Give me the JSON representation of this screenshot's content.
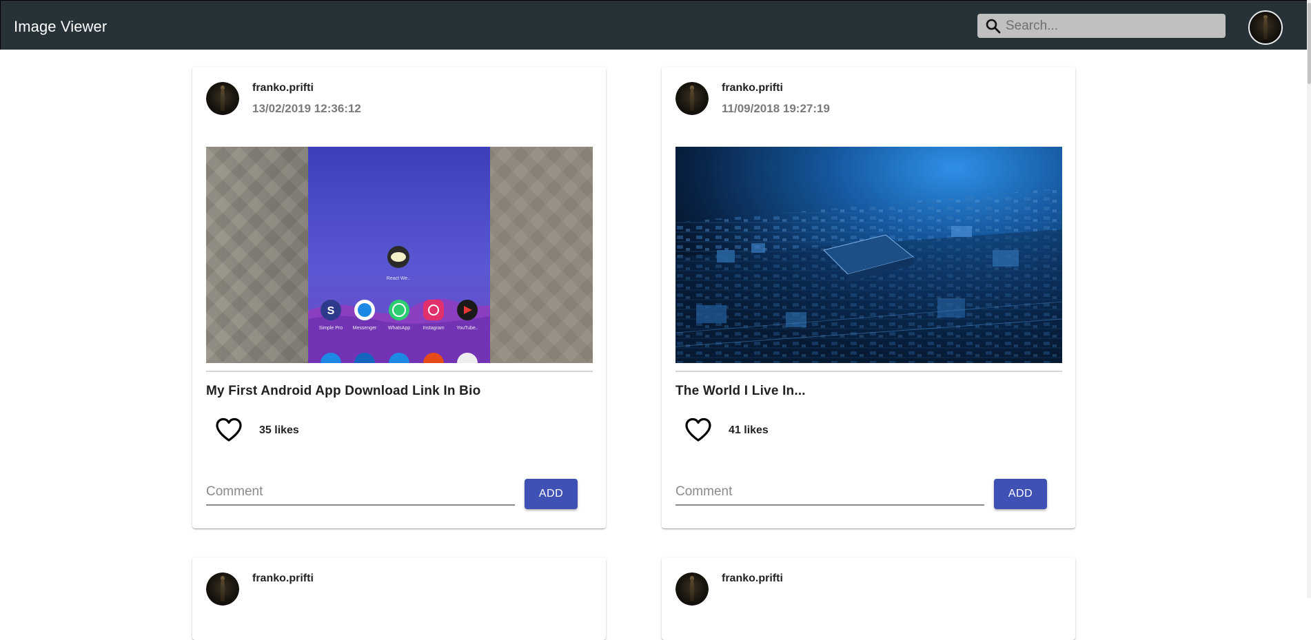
{
  "header": {
    "title": "Image Viewer",
    "search_placeholder": "Search..."
  },
  "posts": [
    {
      "username": "franko.prifti",
      "date": "13/02/2019 12:36:12",
      "caption": "My First Android App Download Link In Bio",
      "likes": "35 likes",
      "comment_placeholder": "Comment",
      "add_label": "ADD",
      "image_app_labels": [
        "React We..",
        "Simple Pro",
        "Messenger",
        "WhatsApp",
        "Instagram",
        "YouTube.."
      ]
    },
    {
      "username": "franko.prifti",
      "date": "11/09/2018 19:27:19",
      "caption": "The World I Live In...",
      "likes": "41 likes",
      "comment_placeholder": "Comment",
      "add_label": "ADD"
    },
    {
      "username": "franko.prifti",
      "date": ""
    },
    {
      "username": "franko.prifti",
      "date": ""
    }
  ],
  "colors": {
    "header_bg": "#263238",
    "primary": "#3f51b5",
    "search_bg": "#c0c0c0"
  }
}
